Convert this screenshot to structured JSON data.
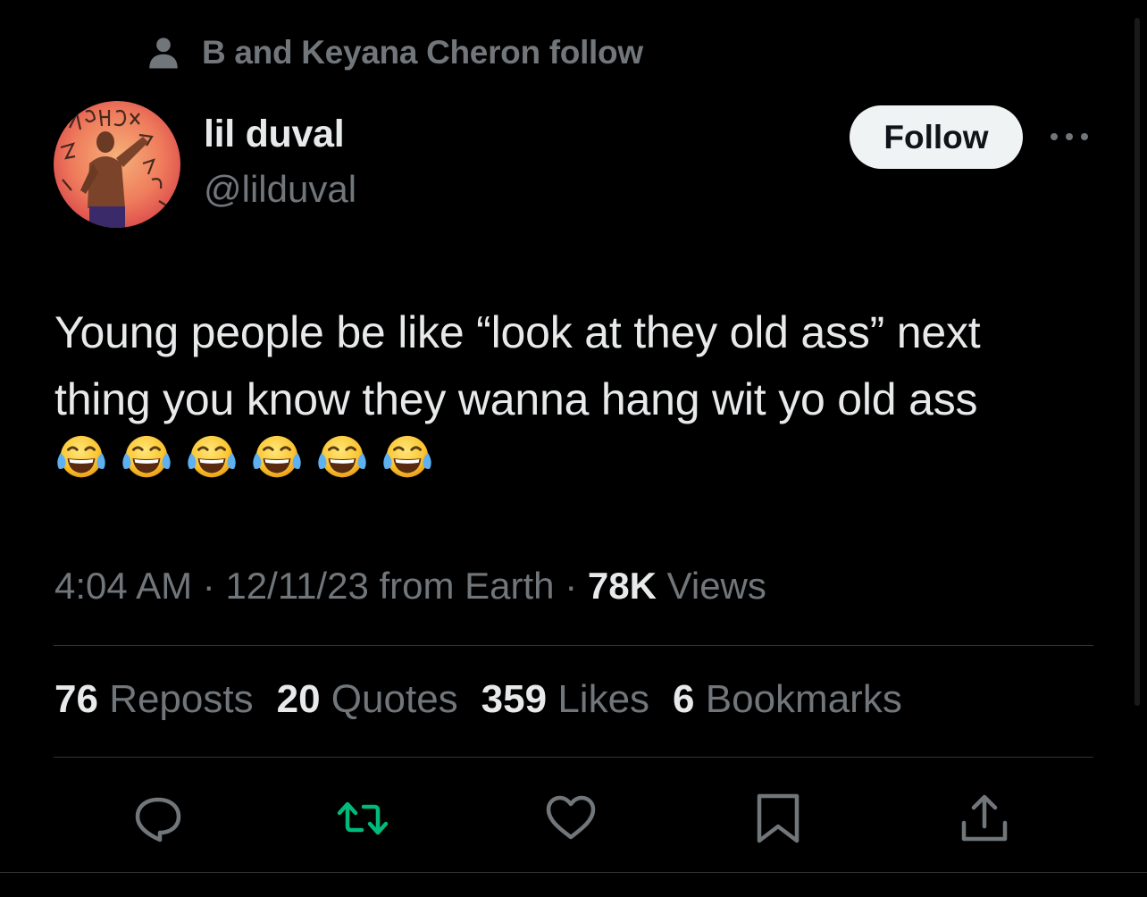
{
  "social_context": {
    "text": "B and Keyana Cheron follow",
    "icon": "person-icon"
  },
  "author": {
    "display_name": "lil duval",
    "handle": "@lilduval",
    "avatar_icon": "avatar-photo"
  },
  "follow_button": {
    "label": "Follow"
  },
  "tweet": {
    "text_line_1": "Young people be like “look at they old ass” next",
    "text_line_2": "thing you know they wanna hang wit yo old ass",
    "emojis": [
      "😂",
      "😂",
      "😂",
      "😂",
      "😂",
      "😂"
    ]
  },
  "meta": {
    "time": "4:04 AM",
    "sep1": " · ",
    "date": "12/11/23",
    "source": " from Earth",
    "sep2": " · ",
    "views_count": "78K",
    "views_label": " Views"
  },
  "stats": {
    "reposts_count": "76",
    "reposts_label": "Reposts",
    "quotes_count": "20",
    "quotes_label": "Quotes",
    "likes_count": "359",
    "likes_label": "Likes",
    "bookmarks_count": "6",
    "bookmarks_label": "Bookmarks"
  },
  "actions": [
    {
      "icon": "reply-icon"
    },
    {
      "icon": "repost-icon"
    },
    {
      "icon": "like-icon"
    },
    {
      "icon": "bookmark-icon"
    },
    {
      "icon": "share-icon"
    }
  ],
  "colors": {
    "background": "#000000",
    "primary_text": "#e7e9ea",
    "secondary_text": "#71767b",
    "repost_green": "#00ba7c",
    "divider": "#2f3336"
  }
}
